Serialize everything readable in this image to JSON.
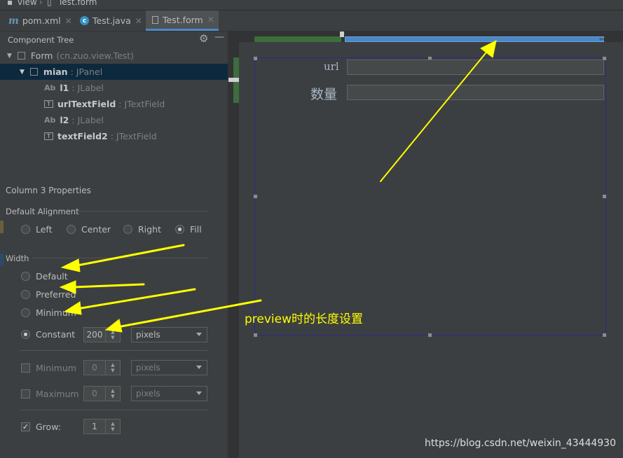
{
  "breadcrumb": {
    "icon": "folder-icon",
    "items": [
      "view",
      "Test.form"
    ]
  },
  "tabs": [
    {
      "label": "pom.xml",
      "icon": "maven-icon",
      "active": false
    },
    {
      "label": "Test.java",
      "icon": "java-class-icon",
      "active": false
    },
    {
      "label": "Test.form",
      "icon": "form-file-icon",
      "active": true
    }
  ],
  "component_tree": {
    "title": "Component Tree",
    "rows": [
      {
        "name": "Form",
        "detail": "(cn.zuo.view.Test)"
      },
      {
        "name": "mian",
        "detail": "JPanel"
      },
      {
        "name": "l1",
        "detail": "JLabel",
        "icon": "Ab"
      },
      {
        "name": "urlTextField",
        "detail": "JTextField"
      },
      {
        "name": "l2",
        "detail": "JLabel",
        "icon": "Ab"
      },
      {
        "name": "textField2",
        "detail": "JTextField"
      }
    ]
  },
  "properties": {
    "title": "Column 3 Properties",
    "default_alignment": {
      "label": "Default Alignment",
      "options": [
        "Left",
        "Center",
        "Right",
        "Fill"
      ],
      "selected": "Fill"
    },
    "width": {
      "label": "Width",
      "options": [
        "Default",
        "Preferred",
        "Minimum",
        "Constant"
      ],
      "selected": "Constant",
      "constant_value": "200",
      "constant_unit": "pixels"
    },
    "minimum": {
      "label": "Minimum",
      "checked": false,
      "value": "0",
      "unit": "pixels"
    },
    "maximum": {
      "label": "Maximum",
      "checked": false,
      "value": "0",
      "unit": "pixels"
    },
    "grow": {
      "label": "Grow:",
      "checked": true,
      "value": "1"
    }
  },
  "designer": {
    "form_labels": [
      "url",
      "数量"
    ]
  },
  "annotation": "preview时的长度设置",
  "watermark": "https://blog.csdn.net/weixin_43444930",
  "colors": {
    "accent": "#4a88c7",
    "annotation": "#ffff00",
    "selection": "#0d293e"
  }
}
